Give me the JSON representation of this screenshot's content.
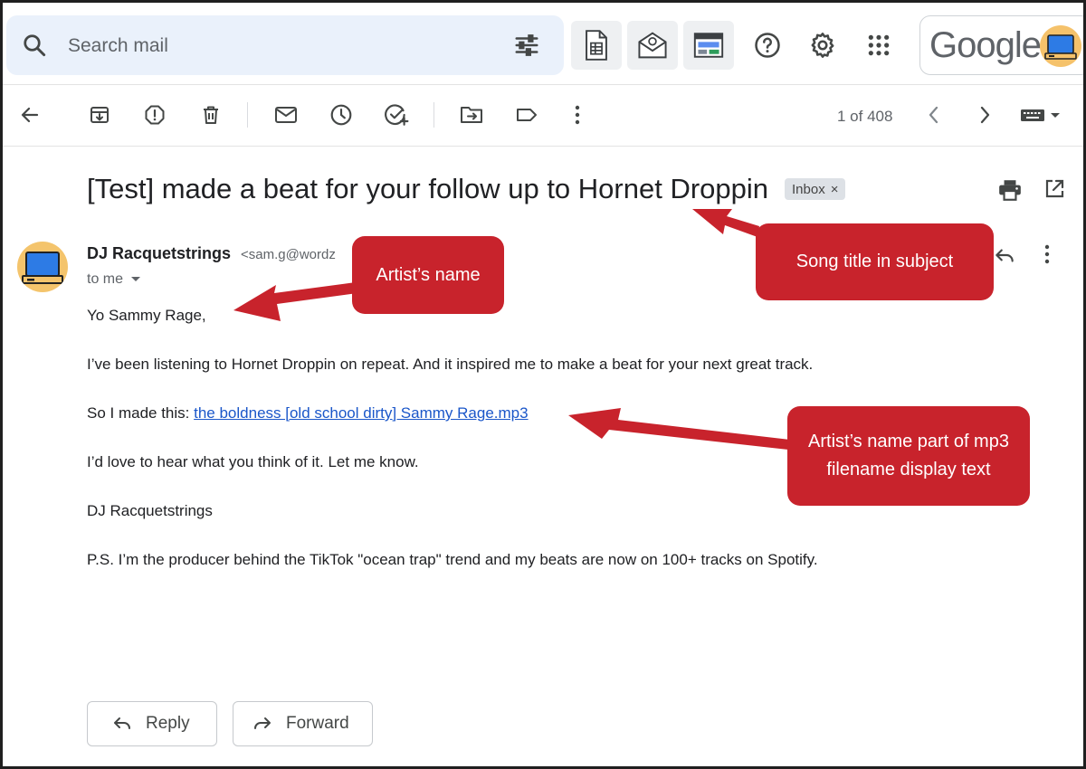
{
  "search": {
    "placeholder": "Search mail"
  },
  "brand": {
    "logo_text": "Google"
  },
  "toolbar": {
    "pager": "1 of 408"
  },
  "message": {
    "subject": "[Test] made a beat for your follow up to Hornet Droppin",
    "label_chip": "Inbox",
    "chip_close": "×",
    "sender_name": "DJ Racquetstrings",
    "sender_email": "<sam.g@wordz",
    "recipient": "to me",
    "greeting": "Yo Sammy Rage,",
    "para1": "I’ve been listening to Hornet Droppin on repeat. And it inspired me to make a beat for your next great track.",
    "para2_prefix": "So I made this: ",
    "para2_link": "the boldness [old school dirty] Sammy Rage.mp3",
    "para3": "I’d love to hear what you think of it. Let me know.",
    "signature": "DJ Racquetstrings",
    "postscript": "P.S. I’m the producer behind the TikTok \"ocean trap\" trend and my beats are now on 100+ tracks on Spotify."
  },
  "actions": {
    "reply": "Reply",
    "forward": "Forward"
  },
  "callouts": {
    "artist": "Artist’s name",
    "song": "Song title in subject",
    "mp3_line1": "Artist’s name part of mp3",
    "mp3_line2": "filename display text"
  },
  "colors": {
    "callout": "#c8232c",
    "link": "#1a56c9",
    "search_bg": "#eaf1fb"
  }
}
